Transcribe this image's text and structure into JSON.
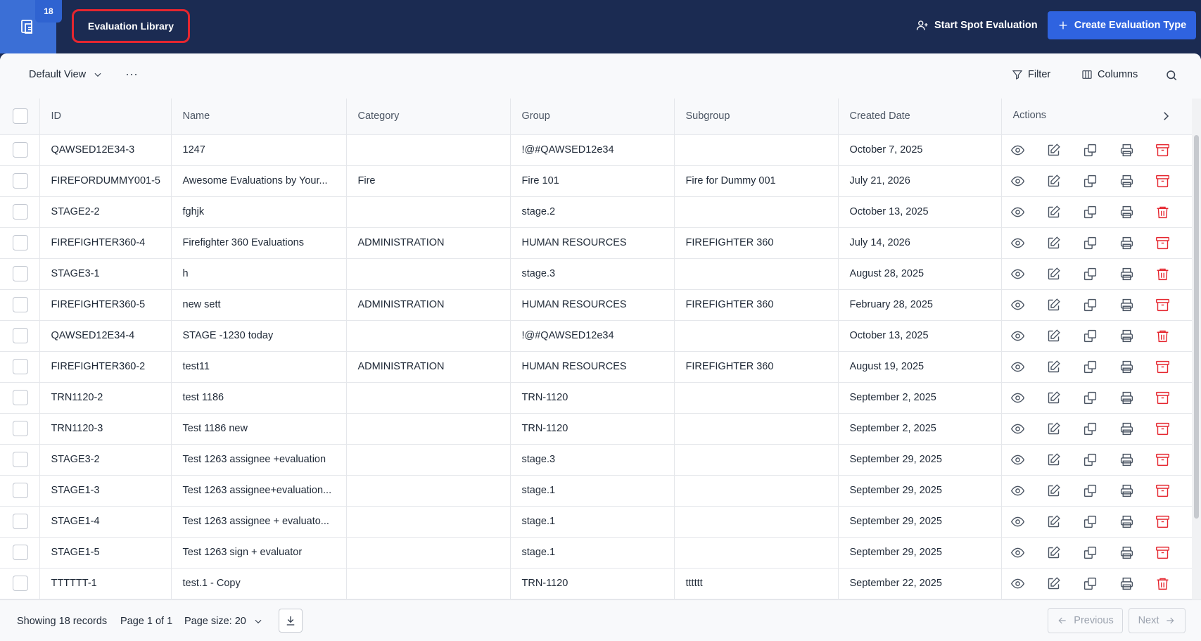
{
  "app": {
    "badge_count": "18",
    "active_tab": "Evaluation Library",
    "spot_button": "Start Spot Evaluation",
    "create_button": "Create Evaluation Type"
  },
  "toolbar": {
    "view_label": "Default View",
    "more_label": "···",
    "filter_label": "Filter",
    "columns_label": "Columns"
  },
  "table": {
    "headers": [
      "ID",
      "Name",
      "Category",
      "Group",
      "Subgroup",
      "Created Date",
      "Actions"
    ],
    "rows": [
      {
        "id": "QAWSED12E34-3",
        "name": "1247",
        "category": "",
        "group": "!@#QAWSED12e34",
        "subgroup": "",
        "date": "October 7, 2025",
        "last_action": "archive-icon"
      },
      {
        "id": "FIREFORDUMMY001-5",
        "name": "Awesome Evaluations by Your...",
        "category": "Fire",
        "group": "Fire 101",
        "subgroup": "Fire for Dummy 001",
        "date": "July 21, 2026",
        "last_action": "archive-icon"
      },
      {
        "id": "STAGE2-2",
        "name": "fghjk",
        "category": "",
        "group": "stage.2",
        "subgroup": "",
        "date": "October 13, 2025",
        "last_action": "trash-icon"
      },
      {
        "id": "FIREFIGHTER360-4",
        "name": "Firefighter 360 Evaluations",
        "category": "ADMINISTRATION",
        "group": "HUMAN RESOURCES",
        "subgroup": "FIREFIGHTER 360",
        "date": "July 14, 2026",
        "last_action": "archive-icon"
      },
      {
        "id": "STAGE3-1",
        "name": "h",
        "category": "",
        "group": "stage.3",
        "subgroup": "",
        "date": "August 28, 2025",
        "last_action": "trash-icon"
      },
      {
        "id": "FIREFIGHTER360-5",
        "name": "new sett",
        "category": "ADMINISTRATION",
        "group": "HUMAN RESOURCES",
        "subgroup": "FIREFIGHTER 360",
        "date": "February 28, 2025",
        "last_action": "archive-icon"
      },
      {
        "id": "QAWSED12E34-4",
        "name": "STAGE -1230 today",
        "category": "",
        "group": "!@#QAWSED12e34",
        "subgroup": "",
        "date": "October 13, 2025",
        "last_action": "trash-icon"
      },
      {
        "id": "FIREFIGHTER360-2",
        "name": "test11",
        "category": "ADMINISTRATION",
        "group": "HUMAN RESOURCES",
        "subgroup": "FIREFIGHTER 360",
        "date": "August 19, 2025",
        "last_action": "archive-icon"
      },
      {
        "id": "TRN1120-2",
        "name": "test 1186",
        "category": "",
        "group": "TRN-1120",
        "subgroup": "",
        "date": "September 2, 2025",
        "last_action": "archive-icon"
      },
      {
        "id": "TRN1120-3",
        "name": "Test 1186 new",
        "category": "",
        "group": "TRN-1120",
        "subgroup": "",
        "date": "September 2, 2025",
        "last_action": "archive-icon"
      },
      {
        "id": "STAGE3-2",
        "name": "Test 1263 assignee +evaluation",
        "category": "",
        "group": "stage.3",
        "subgroup": "",
        "date": "September 29, 2025",
        "last_action": "archive-icon"
      },
      {
        "id": "STAGE1-3",
        "name": "Test 1263 assignee+evaluation...",
        "category": "",
        "group": "stage.1",
        "subgroup": "",
        "date": "September 29, 2025",
        "last_action": "archive-icon"
      },
      {
        "id": "STAGE1-4",
        "name": "Test 1263 assignee + evaluato...",
        "category": "",
        "group": "stage.1",
        "subgroup": "",
        "date": "September 29, 2025",
        "last_action": "archive-icon"
      },
      {
        "id": "STAGE1-5",
        "name": "Test 1263 sign + evaluator",
        "category": "",
        "group": "stage.1",
        "subgroup": "",
        "date": "September 29, 2025",
        "last_action": "archive-icon"
      },
      {
        "id": "TTTTTT-1",
        "name": "test.1 - Copy",
        "category": "",
        "group": "TRN-1120",
        "subgroup": "tttttt",
        "date": "September 22, 2025",
        "last_action": "trash-icon"
      }
    ]
  },
  "footer": {
    "records": "Showing 18 records",
    "page": "Page 1 of 1",
    "page_size": "Page size: 20",
    "previous": "Previous",
    "next": "Next"
  },
  "colors": {
    "header_bg": "#1b2b52",
    "accent": "#2f63e0",
    "danger": "#e5262f"
  }
}
